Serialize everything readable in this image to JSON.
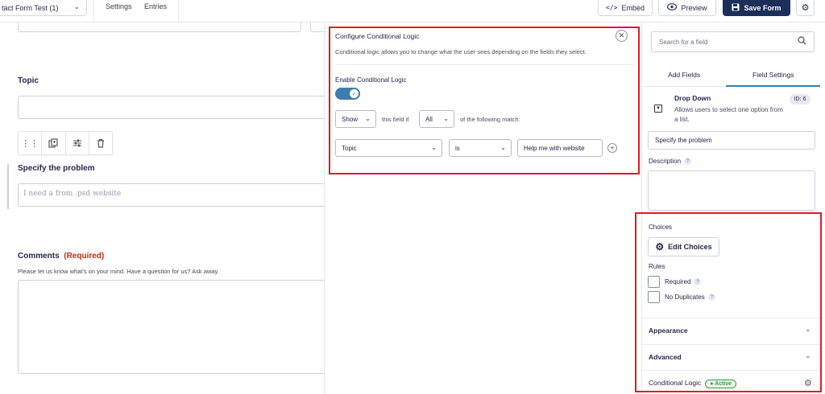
{
  "topbar": {
    "form_name": "tact Form Test (1)",
    "settings": "Settings",
    "entries": "Entries",
    "embed": "Embed",
    "preview": "Preview",
    "save": "Save Form"
  },
  "canvas": {
    "topic_label": "Topic",
    "problem_label": "Specify the problem",
    "problem_placeholder": "I need a from .psd website",
    "comments_label": "Comments",
    "comments_required": "(Required)",
    "comments_help": "Please let us know what's on your mind. Have a question for us? Ask away."
  },
  "conditional_logic": {
    "title": "Configure Conditional Logic",
    "description": "Conditional logic allows you to change what the user sees depending on the fields they select.",
    "enable_label": "Enable Conditional Logic",
    "enabled": true,
    "action": "Show",
    "text_if": "this field if",
    "match": "All",
    "text_following": "of the following match:",
    "rule_field": "Topic",
    "rule_operator": "is",
    "rule_value": "Help me with website"
  },
  "sidebar": {
    "search_placeholder": "Search for a field",
    "tab_add": "Add Fields",
    "tab_settings": "Field Settings",
    "field_type": "Drop Down",
    "field_type_desc": "Allows users to select one option from a list.",
    "field_id": "ID: 6",
    "field_label_value": "Specify the problem",
    "description_label": "Description",
    "choices_label": "Choices",
    "edit_choices": "Edit Choices",
    "rules_label": "Rules",
    "rule_required": "Required",
    "rule_no_duplicates": "No Duplicates",
    "appearance": "Appearance",
    "advanced": "Advanced",
    "conditional_logic": "Conditional Logic",
    "active_badge": "Active"
  },
  "colors": {
    "accent": "#3e7dab",
    "save_button": "#1c2f5a",
    "highlight_outline": "#e01b24",
    "active_green": "#2f9e44",
    "required_red": "#c02b0a"
  }
}
